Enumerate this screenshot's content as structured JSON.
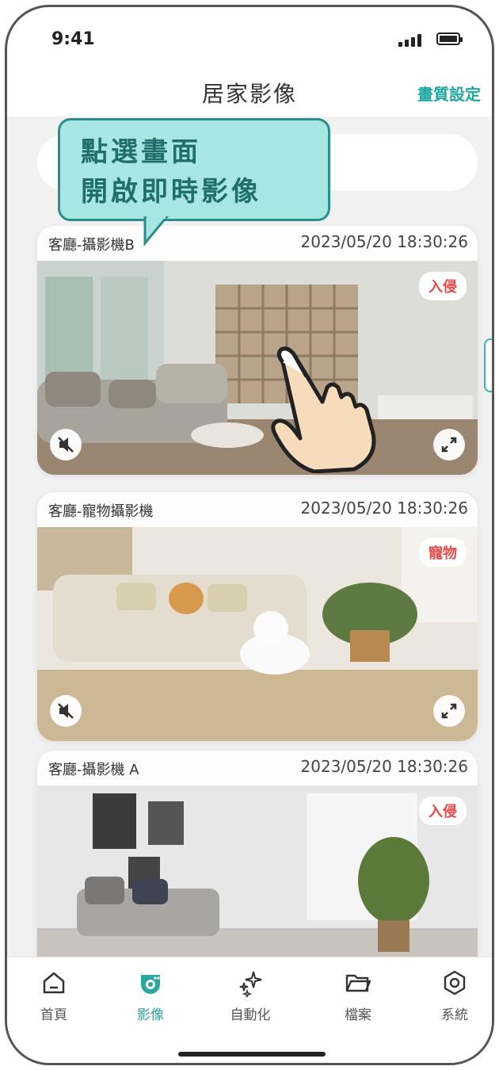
{
  "status_bar": {
    "time": "9:41"
  },
  "header": {
    "title": "居家影像",
    "quality_settings": "畫質設定"
  },
  "tooltip": {
    "line1": "點選畫面",
    "line2": "開啟即時影像"
  },
  "cameras": [
    {
      "name": "客廳-攝影機B",
      "timestamp": "2023/05/20 18:30:26",
      "badge": "入侵"
    },
    {
      "name": "客廳-寵物攝影機",
      "timestamp": "2023/05/20 18:30:26",
      "badge": "寵物"
    },
    {
      "name": "客廳-攝影機 A",
      "timestamp": "2023/05/20 18:30:26",
      "badge": "入侵"
    }
  ],
  "nav": [
    {
      "label": "首頁",
      "icon": "home-icon"
    },
    {
      "label": "影像",
      "icon": "camera-icon",
      "active": true
    },
    {
      "label": "自動化",
      "icon": "sparkle-icon"
    },
    {
      "label": "檔案",
      "icon": "folder-icon"
    },
    {
      "label": "系統",
      "icon": "hexagon-settings-icon"
    }
  ],
  "colors": {
    "accent": "#2aa79f",
    "alert": "#e84b4b",
    "tooltip_bg": "#a8e6e4"
  }
}
